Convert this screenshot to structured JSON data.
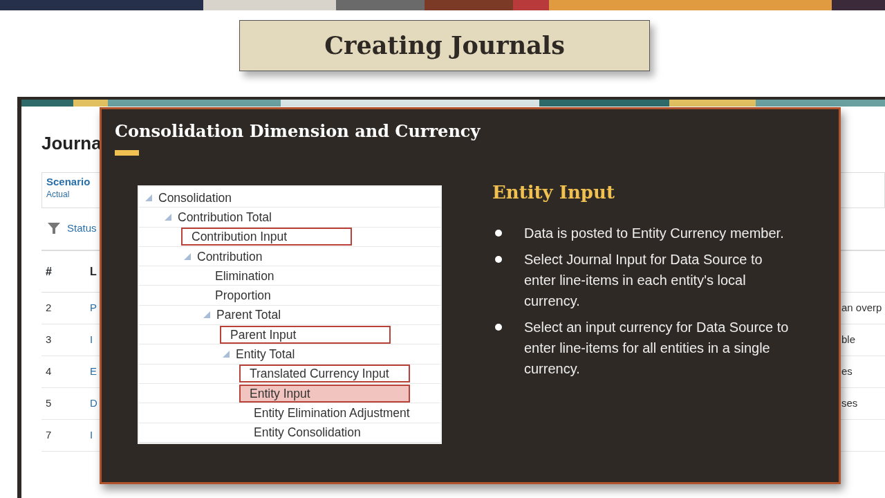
{
  "slide_title": "Creating Journals",
  "app": {
    "page_title": "Journa",
    "pov": [
      {
        "label": "Scenario",
        "value": "Actual"
      }
    ],
    "filter": {
      "label": "Status"
    },
    "table": {
      "columns": [
        "#",
        "L"
      ],
      "rows": [
        {
          "number": "2",
          "name": "P",
          "column_3": "an overp"
        },
        {
          "number": "3",
          "name": "I",
          "column_3": "ble"
        },
        {
          "number": "4",
          "name": "E",
          "column_3": "es"
        },
        {
          "number": "5",
          "name": "D",
          "column_3": "ses"
        },
        {
          "number": "7",
          "name": "I",
          "column_3": ""
        }
      ]
    }
  },
  "overlay": {
    "title": "Consolidation Dimension and Currency",
    "tree": [
      {
        "label": "Consolidation",
        "expanded": true,
        "boxed": false,
        "selected": false,
        "children": [
          {
            "label": "Contribution Total",
            "expanded": true,
            "boxed": false,
            "selected": false,
            "children": [
              {
                "label": "Contribution Input",
                "boxed": true,
                "selected": false
              },
              {
                "label": "Contribution",
                "expanded": true,
                "boxed": false,
                "selected": false,
                "children": [
                  {
                    "label": "Elimination",
                    "boxed": false,
                    "selected": false
                  },
                  {
                    "label": "Proportion",
                    "boxed": false,
                    "selected": false
                  },
                  {
                    "label": "Parent Total",
                    "expanded": true,
                    "boxed": false,
                    "selected": false,
                    "children": [
                      {
                        "label": "Parent Input",
                        "boxed": true,
                        "selected": false
                      },
                      {
                        "label": "Entity Total",
                        "expanded": true,
                        "boxed": false,
                        "selected": false,
                        "children": [
                          {
                            "label": "Translated Currency Input",
                            "boxed": true,
                            "selected": false
                          },
                          {
                            "label": "Entity Input",
                            "boxed": true,
                            "selected": true
                          },
                          {
                            "label": "Entity Elimination Adjustment",
                            "boxed": false,
                            "selected": false
                          },
                          {
                            "label": "Entity Consolidation",
                            "boxed": false,
                            "selected": false
                          }
                        ]
                      }
                    ]
                  }
                ]
              }
            ]
          }
        ]
      }
    ],
    "heading": "Entity Input",
    "bullets": [
      "Data is posted to Entity Currency member.",
      "Select Journal Input for Data Source to enter line-items in each entity's local currency.",
      "Select an input currency for Data Source to enter line-items for all entities in a single currency."
    ]
  }
}
